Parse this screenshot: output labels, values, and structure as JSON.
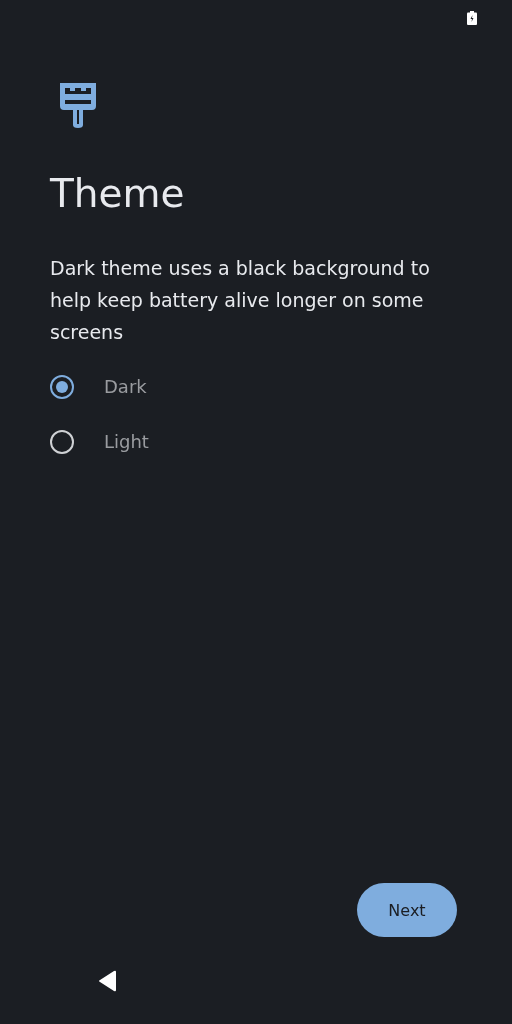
{
  "title": "Theme",
  "description": "Dark theme uses a black background to help keep battery alive longer on some screens",
  "options": [
    {
      "label": "Dark",
      "selected": true
    },
    {
      "label": "Light",
      "selected": false
    }
  ],
  "next_button": "Next"
}
